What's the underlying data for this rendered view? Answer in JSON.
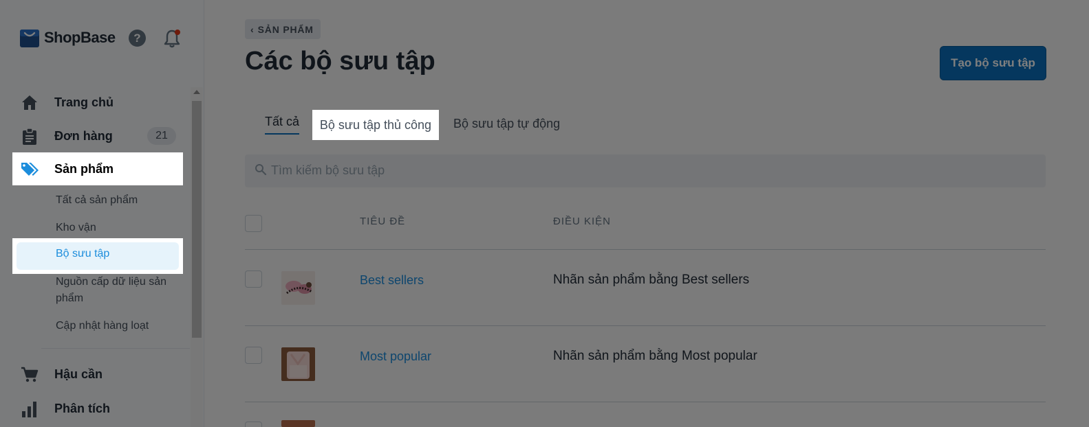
{
  "brand": {
    "name": "ShopBase"
  },
  "sidebar": {
    "items": [
      {
        "label": "Trang chủ",
        "icon": "home-icon"
      },
      {
        "label": "Đơn hàng",
        "icon": "clipboard-icon",
        "badge": "21"
      },
      {
        "label": "Sản phẩm",
        "icon": "tag-icon"
      },
      {
        "label": "Hậu cần",
        "icon": "cart-icon"
      },
      {
        "label": "Phân tích",
        "icon": "bar-chart-icon"
      }
    ],
    "subitems": [
      {
        "label": "Tất cả sản phẩm"
      },
      {
        "label": "Kho vận"
      },
      {
        "label": "Bộ sưu tập"
      },
      {
        "label": "Nguồn cấp dữ liệu sản phẩm"
      },
      {
        "label": "Cập nhật hàng loạt"
      }
    ]
  },
  "header": {
    "back_label": "SẢN PHẨM",
    "title": "Các bộ sưu tập",
    "create_button": "Tạo bộ sưu tập"
  },
  "tabs": [
    {
      "label": "Tất cả"
    },
    {
      "label": "Bộ sưu tập thủ công"
    },
    {
      "label": "Bộ sưu tập tự động"
    }
  ],
  "search": {
    "placeholder": "Tìm kiếm bộ sưu tập"
  },
  "table": {
    "columns": [
      "TIÊU ĐỀ",
      "ĐIỀU KIỆN"
    ],
    "rows": [
      {
        "title": "Best sellers",
        "condition": "Nhãn sản phẩm bằng Best sellers"
      },
      {
        "title": "Most popular",
        "condition": "Nhãn sản phẩm bằng Most popular"
      }
    ]
  },
  "colors": {
    "accent": "#0b6fbc",
    "link": "#1c8ddc",
    "notification": "#de3618",
    "overlay": "rgba(0,0,0,0.5)"
  }
}
